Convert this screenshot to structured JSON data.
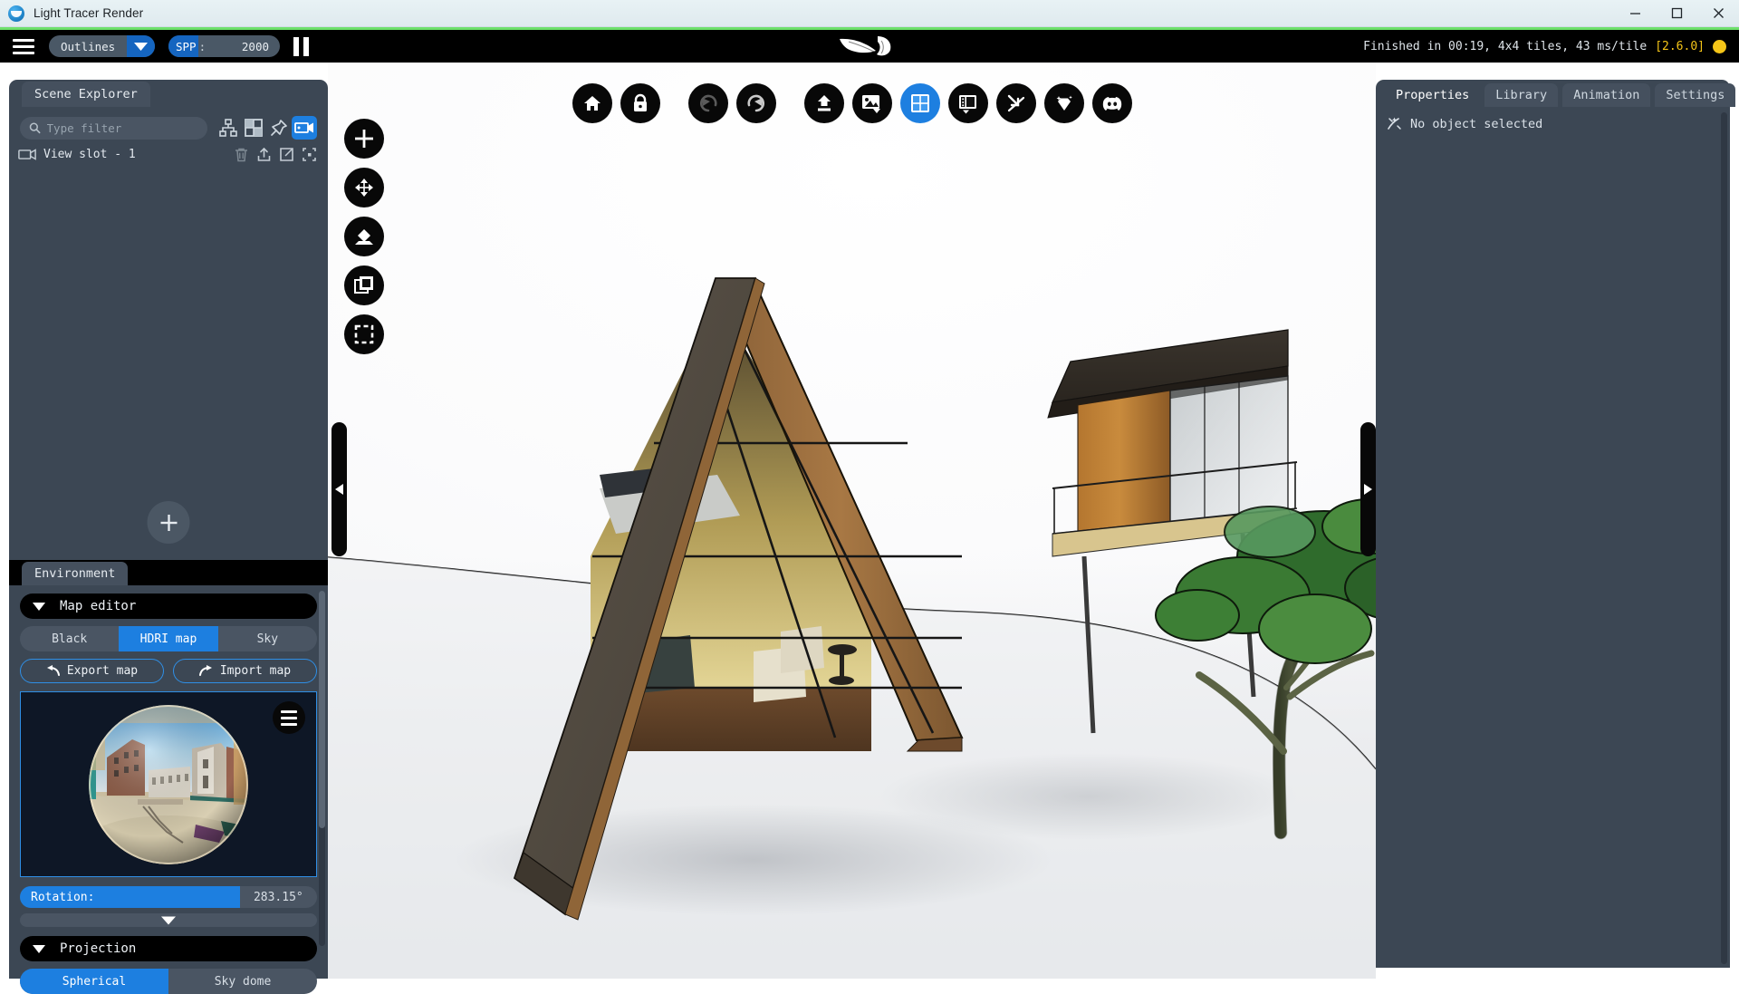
{
  "window": {
    "title": "Light Tracer Render",
    "app_icon": "lighttracer-logo-icon",
    "minimize": "minimize-icon",
    "maximize": "maximize-icon",
    "close": "close-icon"
  },
  "topbar": {
    "menu_icon": "hamburger-menu-icon",
    "mode": {
      "value": "Outlines",
      "caret": "chevron-down-icon"
    },
    "spp": {
      "label": "SPP",
      "separator": ":",
      "value": "2000"
    },
    "pause": "pause-icon",
    "brand": "feather-logo-icon",
    "status": "Finished in 00:19, 4x4 tiles, 43 ms/tile",
    "version": "[2.6.0]",
    "status_dot_color": "#f5c518",
    "progress_color": "#6de06a"
  },
  "toolbar_top": [
    {
      "name": "home-button",
      "icon": "home-icon",
      "active": false
    },
    {
      "name": "lock-button",
      "icon": "lock-icon",
      "active": false
    },
    {
      "name": "undo-button",
      "icon": "undo-arrow-icon",
      "active": false
    },
    {
      "name": "redo-button",
      "icon": "redo-arrow-icon",
      "active": false
    },
    {
      "name": "upload-model-button",
      "icon": "upload-arrow-icon",
      "active": false
    },
    {
      "name": "render-image-button",
      "icon": "image-icon",
      "active": false
    },
    {
      "name": "grid-layout-button",
      "icon": "grid-four-icon",
      "active": true
    },
    {
      "name": "panel-layout-button",
      "icon": "panel-split-icon",
      "active": false
    },
    {
      "name": "snap-button",
      "icon": "snap-arrow-icon",
      "active": false
    },
    {
      "name": "material-button",
      "icon": "gem-sparkle-icon",
      "active": false
    },
    {
      "name": "discord-button",
      "icon": "discord-icon",
      "active": false
    }
  ],
  "toolbar_left": [
    {
      "name": "add-object-button",
      "icon": "plus-icon"
    },
    {
      "name": "move-tool-button",
      "icon": "move-arrows-icon"
    },
    {
      "name": "ground-plane-button",
      "icon": "diamond-on-plane-icon"
    },
    {
      "name": "duplicate-button",
      "icon": "copy-layers-icon"
    },
    {
      "name": "select-region-button",
      "icon": "dashed-square-icon"
    }
  ],
  "collapse": {
    "left": "collapse-left-arrow-icon",
    "right": "collapse-right-arrow-icon"
  },
  "scene_explorer": {
    "tab": "Scene Explorer",
    "filter_placeholder": "Type filter",
    "filter_value": "",
    "search_icon": "search-icon",
    "view_buttons": [
      {
        "name": "hierarchy-view-button",
        "icon": "hierarchy-tree-icon",
        "active": false
      },
      {
        "name": "grid-view-button",
        "icon": "grid-view-icon",
        "active": false
      },
      {
        "name": "pin-view-button",
        "icon": "pin-icon",
        "active": false
      },
      {
        "name": "camera-view-button",
        "icon": "camera-icon",
        "active": true
      }
    ],
    "slot": {
      "icon": "camera-icon",
      "label": "View slot - 1"
    },
    "slot_actions": [
      {
        "name": "delete-slot-button",
        "icon": "trash-icon"
      },
      {
        "name": "export-slot-button",
        "icon": "export-up-icon"
      },
      {
        "name": "resize-slot-button",
        "icon": "resize-icon"
      },
      {
        "name": "focus-slot-button",
        "icon": "focus-brackets-icon"
      }
    ],
    "add_button": {
      "name": "add-view-slot-button",
      "icon": "plus-icon"
    }
  },
  "environment": {
    "tab": "Environment",
    "map_editor": {
      "label": "Map editor",
      "expanded": true,
      "caret": "triangle-down-icon"
    },
    "map_type": {
      "options": [
        "Black",
        "HDRI map",
        "Sky"
      ],
      "selected": "HDRI map"
    },
    "export_map": {
      "label": "Export map",
      "icon": "arrow-back-icon"
    },
    "import_map": {
      "label": "Import map",
      "icon": "arrow-forward-icon"
    },
    "preview": {
      "name": "hdri-sphere-preview",
      "description": "venice-canal-hdri-sphere",
      "menu_icon": "hamburger-menu-icon"
    },
    "rotation": {
      "label": "Rotation:",
      "value": "283.15°",
      "fill_percent": 74
    },
    "sub_slider": {
      "name": "rotation-fine-slider",
      "thumb": "triangle-down-icon"
    },
    "projection": {
      "label": "Projection",
      "expanded": true,
      "caret": "triangle-down-icon"
    },
    "projection_type": {
      "options": [
        "Spherical",
        "Sky dome"
      ],
      "selected": "Spherical"
    }
  },
  "right_panel": {
    "tabs": [
      {
        "label": "Properties",
        "active": true
      },
      {
        "label": "Library",
        "active": false
      },
      {
        "label": "Animation",
        "active": false
      },
      {
        "label": "Settings",
        "active": false
      }
    ],
    "empty_state": {
      "icon": "no-selection-icon",
      "text": "No object selected"
    }
  },
  "viewport": {
    "name": "render-viewport",
    "scene": "a-frame-house-3d-render",
    "background": "#ffffff"
  },
  "colors": {
    "accent": "#1d7fe0",
    "panel": "#3c4754",
    "panel_dark": "#000000",
    "chip": "#45505e",
    "text": "#e6ebf0",
    "warning": "#f5c518",
    "progress": "#6de06a"
  }
}
